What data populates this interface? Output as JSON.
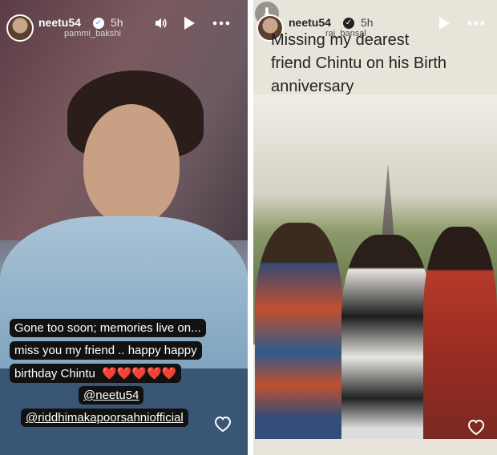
{
  "left_story": {
    "username": "neetu54",
    "time": "5h",
    "mention_tag": "pammi_bakshi",
    "caption_lines": [
      "Gone too soon; memories live on...",
      "miss you my friend .. happy happy",
      "birthday Chintu"
    ],
    "hearts": "❤️❤️❤️❤️❤️",
    "mention_1": "@neetu54",
    "mention_2": "@riddhimakapoorsahniofficial"
  },
  "right_story": {
    "username": "neetu54",
    "time": "5h",
    "mention_tag": "raj_bansal",
    "text_lines": [
      "Missing my dearest",
      "friend Chintu on his Birth",
      "anniversary"
    ]
  },
  "icons": {
    "sound": "speaker-icon",
    "play": "play-icon",
    "more": "more-icon",
    "like": "heart-icon",
    "download": "download-icon"
  },
  "colors": {
    "verified": "#3797f0",
    "caption_bg": "#111111",
    "heart_red": "#d3222a"
  }
}
